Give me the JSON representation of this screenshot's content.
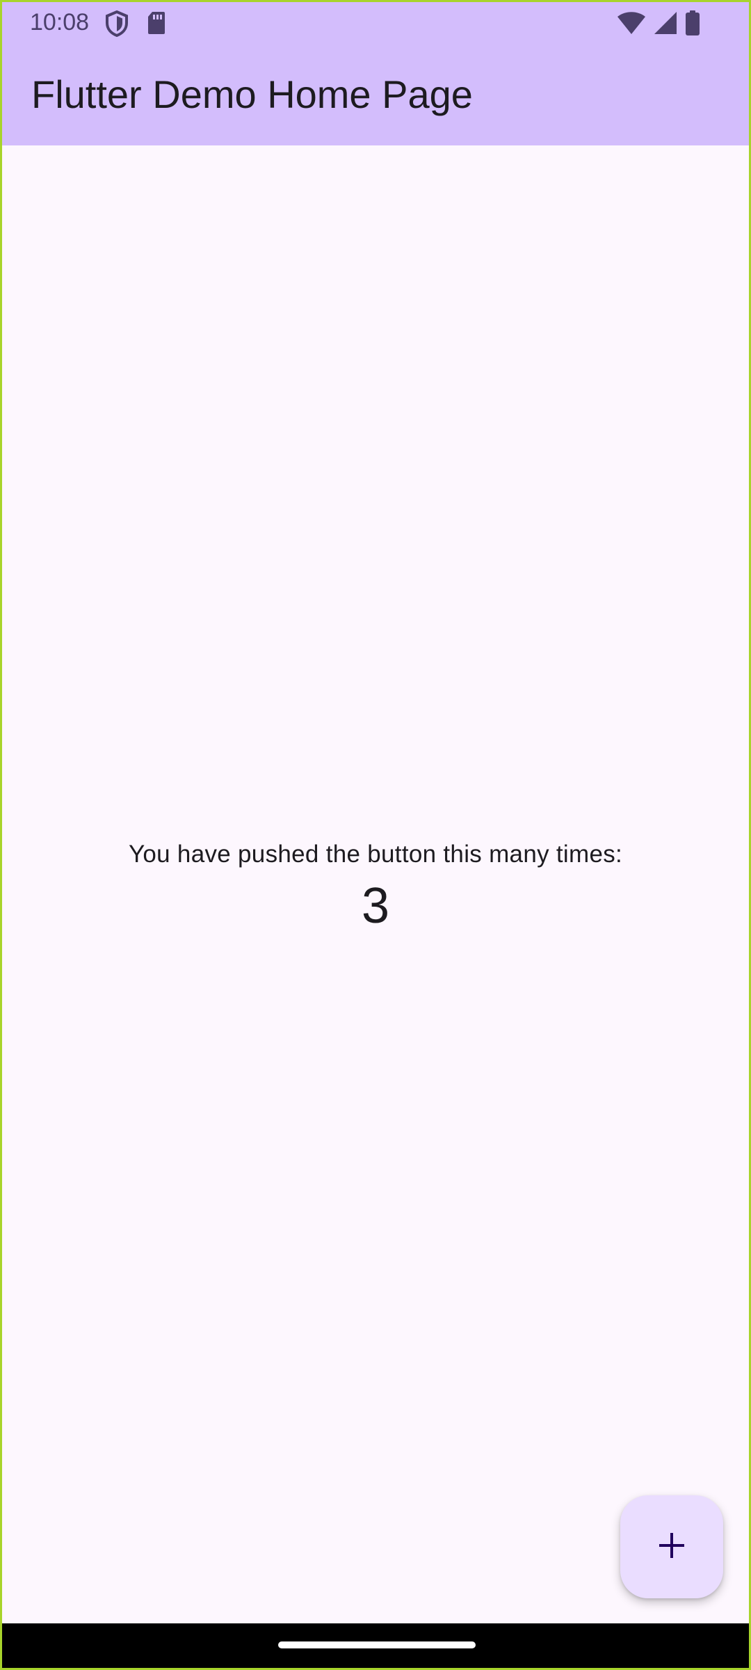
{
  "status_bar": {
    "time": "10:08",
    "icons": [
      "shield-icon",
      "sd-card-icon",
      "wifi-icon",
      "cell-signal-icon",
      "battery-icon"
    ]
  },
  "app_bar": {
    "title": "Flutter Demo Home Page"
  },
  "main": {
    "counter_label": "You have pushed the button this many times:",
    "counter_value": "3"
  },
  "fab": {
    "icon": "add-icon"
  },
  "colors": {
    "app_bar_bg": "#d3bdfc",
    "page_bg": "#fdf7fe",
    "fab_bg": "#eaddff",
    "text": "#1d1b20"
  }
}
